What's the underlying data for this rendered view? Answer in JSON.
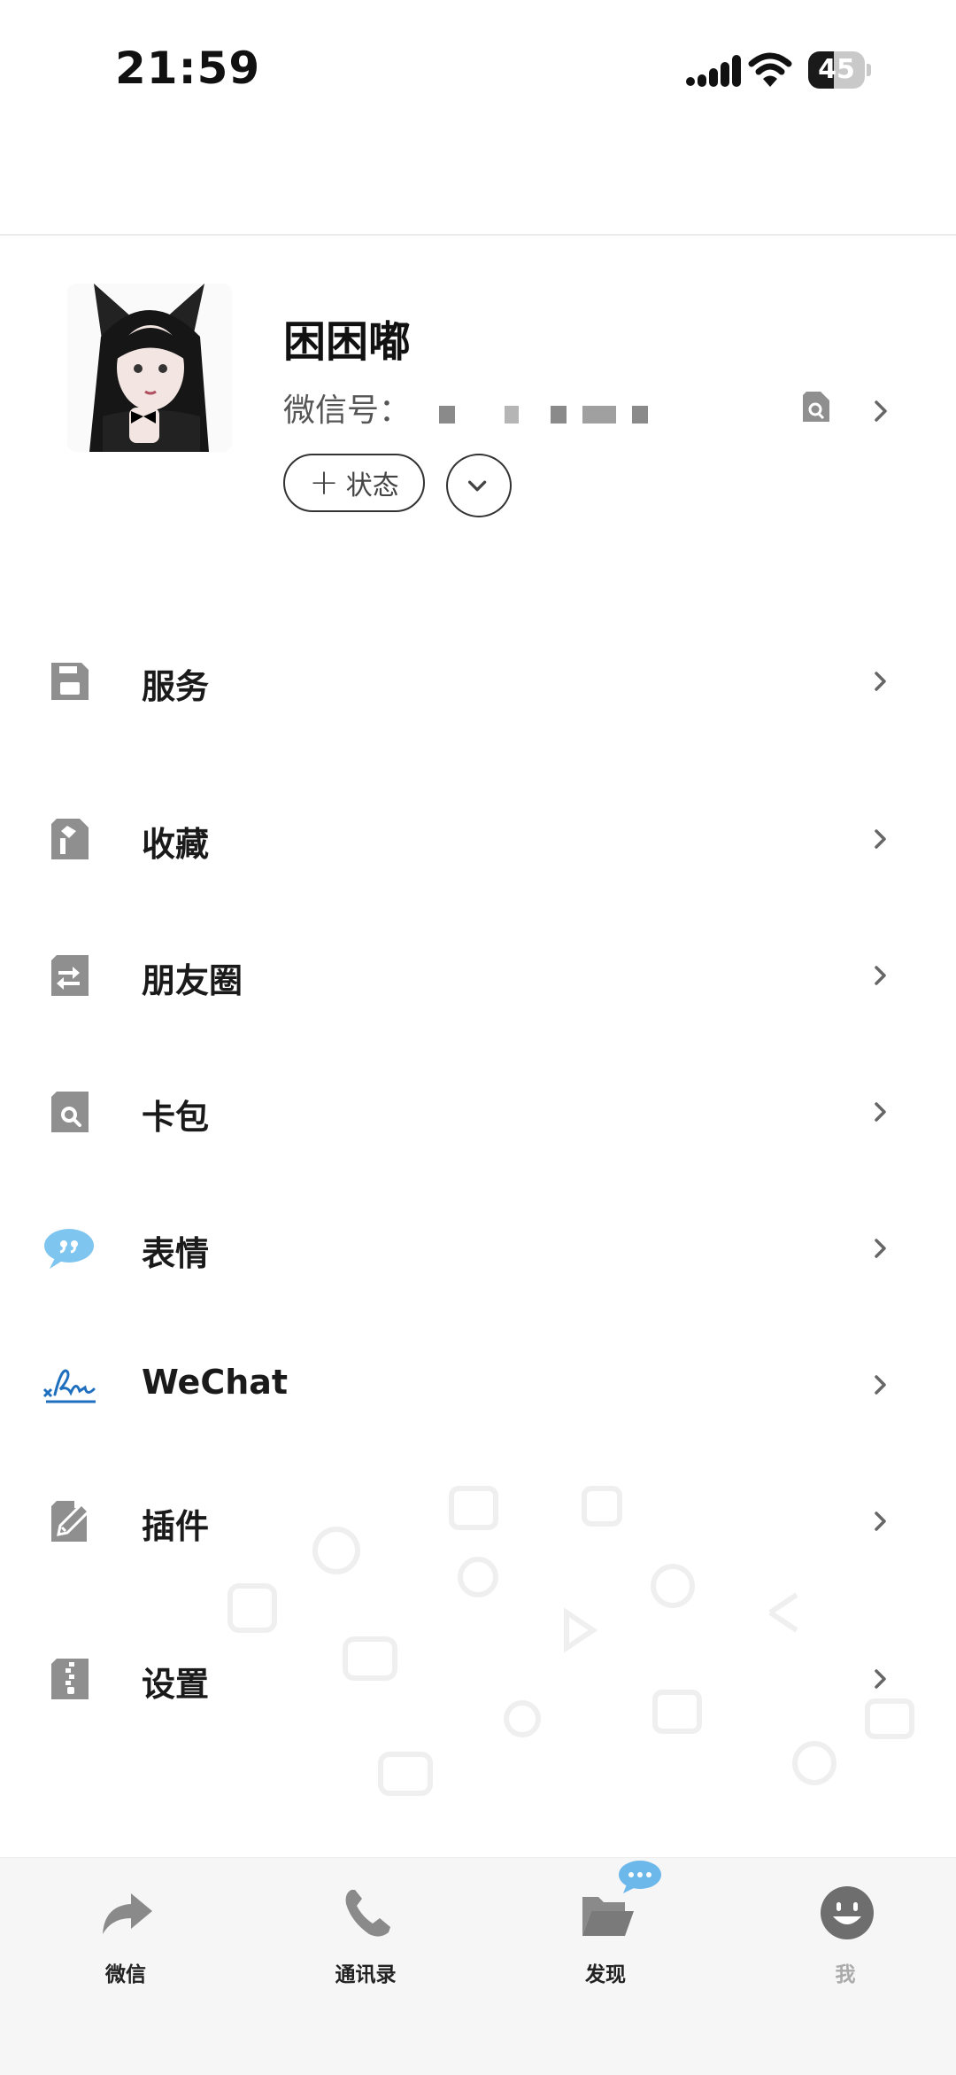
{
  "status_bar": {
    "time": "21:59",
    "battery": "45",
    "battery_level": 0.45
  },
  "profile": {
    "name": "困困嘟",
    "wechat_id_label": "微信号：",
    "status_button_label": "状态",
    "status_button_symbol": "+"
  },
  "menu": [
    {
      "label": "服务",
      "icon": "save-icon"
    },
    {
      "label": "收藏",
      "icon": "bookmark-doc-icon"
    },
    {
      "label": "朋友圈",
      "icon": "moments-doc-icon"
    },
    {
      "label": "卡包",
      "icon": "card-search-icon"
    },
    {
      "label": "表情",
      "icon": "quote-bubble-icon"
    },
    {
      "label": "WeChat",
      "icon": "signature-icon"
    },
    {
      "label": "插件",
      "icon": "plugin-edit-icon"
    },
    {
      "label": "设置",
      "icon": "settings-zip-icon"
    }
  ],
  "tabs": [
    {
      "label": "微信",
      "icon": "share-arrow-icon"
    },
    {
      "label": "通讯录",
      "icon": "phone-icon"
    },
    {
      "label": "发现",
      "icon": "folder-open-icon"
    },
    {
      "label": "我",
      "icon": "smiley-icon"
    }
  ],
  "colors": {
    "accent_blue": "#3aa0e8",
    "icon_gray": "#8f8f8f",
    "tab_bg": "#f6f6f6"
  }
}
